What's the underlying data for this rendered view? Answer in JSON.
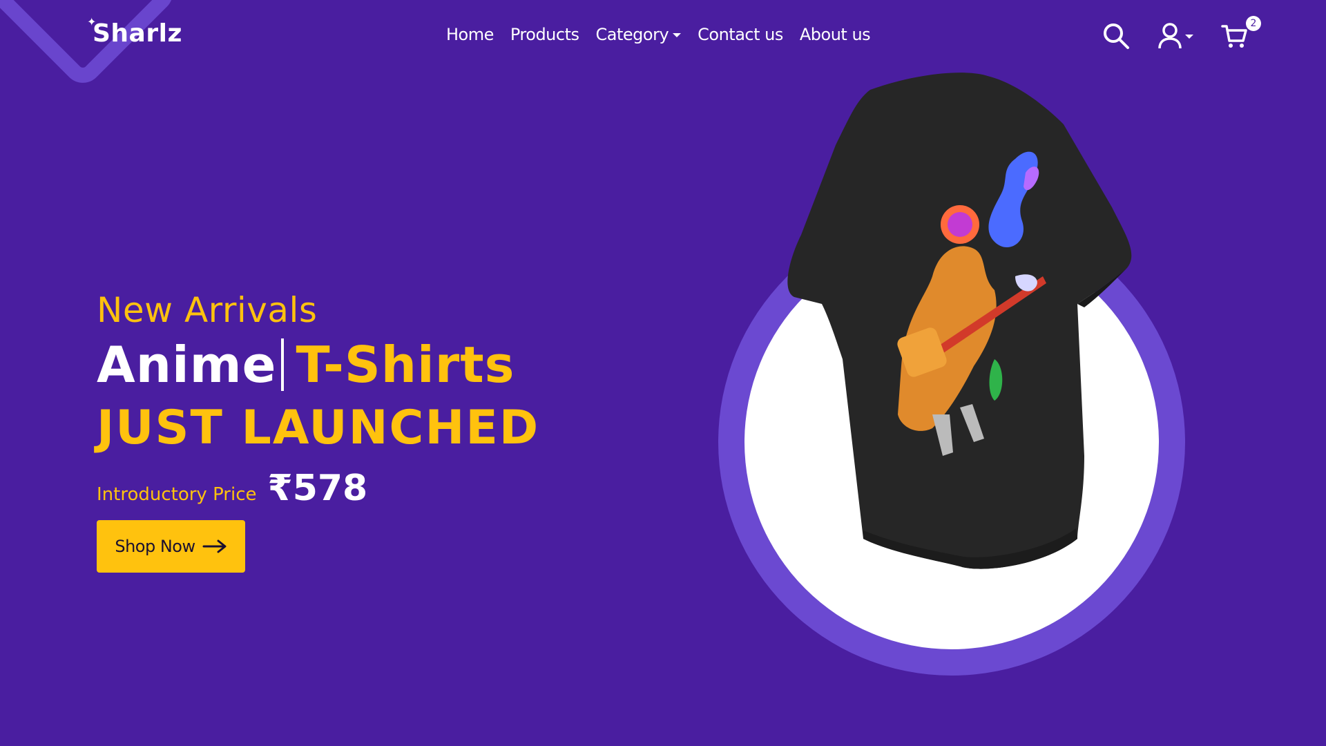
{
  "brand": {
    "logo_text": "Sharlz"
  },
  "nav": {
    "items": [
      {
        "label": "Home"
      },
      {
        "label": "Products"
      },
      {
        "label": "Category"
      },
      {
        "label": "Contact us"
      },
      {
        "label": "About us"
      }
    ]
  },
  "header_icons": {
    "search": "search-icon",
    "account": "user-icon",
    "cart": "cart-icon",
    "cart_count": "2"
  },
  "hero": {
    "eyebrow": "New Arrivals",
    "headline_word1": "Anime",
    "headline_word2": "T-Shirts",
    "subheadline": "JUST LAUNCHED",
    "price_label": "Introductory Price",
    "price_value": "₹578",
    "cta_label": "Shop Now"
  },
  "colors": {
    "background": "#4a1ea0",
    "accent": "#ffc20e",
    "ring": "#6b49d1",
    "text": "#ffffff"
  }
}
